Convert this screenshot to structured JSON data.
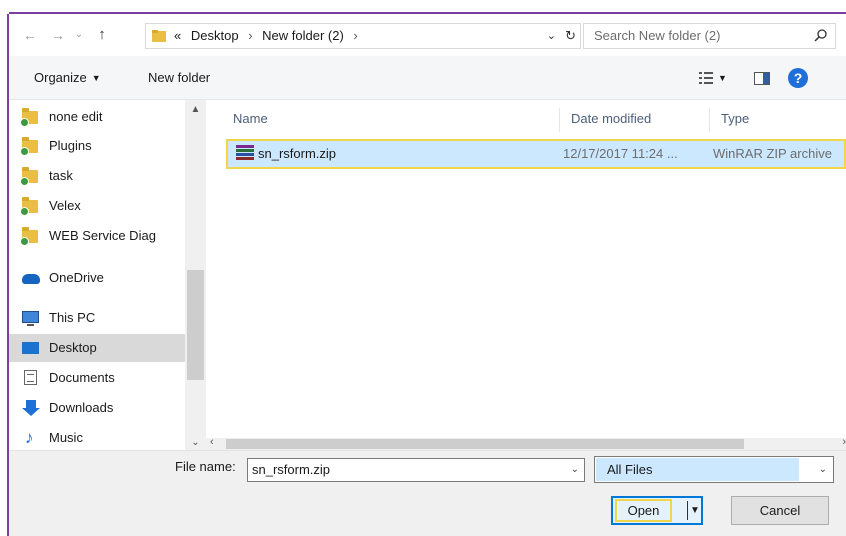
{
  "address_bar": {
    "overflow": "«",
    "crumbs": [
      "Desktop",
      "New folder (2)"
    ],
    "separator": "›",
    "search_placeholder": "Search New folder (2)"
  },
  "toolbar": {
    "organize_label": "Organize",
    "new_folder_label": "New folder",
    "help_label": "?"
  },
  "navigation": {
    "items": [
      {
        "label": "none edit",
        "icon": "folder-sync-icon"
      },
      {
        "label": "Plugins",
        "icon": "folder-sync-icon"
      },
      {
        "label": "task",
        "icon": "folder-sync-icon"
      },
      {
        "label": "Velex",
        "icon": "folder-sync-icon"
      },
      {
        "label": "WEB Service Diag",
        "icon": "folder-sync-icon"
      },
      {
        "label": "OneDrive",
        "icon": "onedrive-icon"
      },
      {
        "label": "This PC",
        "icon": "computer-icon"
      },
      {
        "label": "Desktop",
        "icon": "desktop-icon",
        "selected": true
      },
      {
        "label": "Documents",
        "icon": "documents-icon"
      },
      {
        "label": "Downloads",
        "icon": "downloads-icon"
      },
      {
        "label": "Music",
        "icon": "music-icon"
      }
    ]
  },
  "file_list": {
    "columns": [
      "Name",
      "Date modified",
      "Type"
    ],
    "rows": [
      {
        "name": "sn_rsform.zip",
        "date_modified": "12/17/2017 11:24 ...",
        "type": "WinRAR ZIP archive",
        "icon": "winrar-archive-icon",
        "selected": true
      }
    ]
  },
  "bottom": {
    "file_name_label": "File name:",
    "file_name_value": "sn_rsform.zip",
    "file_type_value": "All Files",
    "open_label": "Open",
    "cancel_label": "Cancel"
  },
  "colors": {
    "frame_accent": "#7b3fa0",
    "highlight_outline": "#f0d64c",
    "selection": "#cce8ff",
    "focus_blue": "#0078d7"
  }
}
